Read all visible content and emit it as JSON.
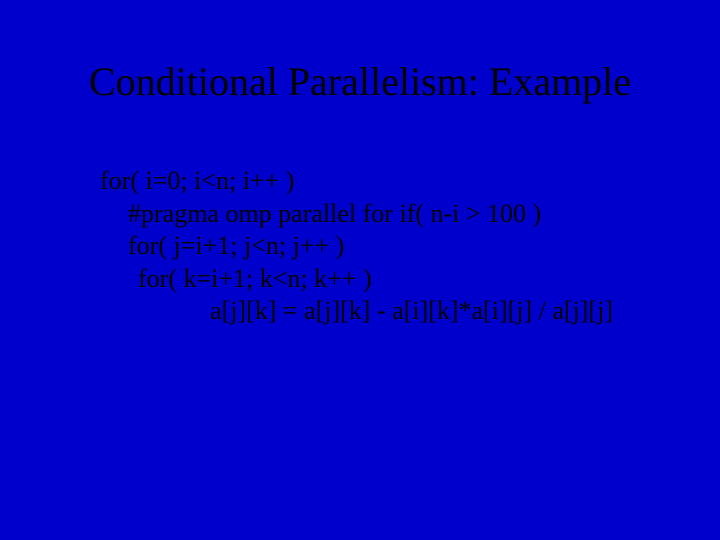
{
  "slide": {
    "title": "Conditional Parallelism: Example",
    "code": {
      "line1": "for( i=0; i<n; i++ )",
      "line2": "#pragma omp parallel for if( n-i > 100 )",
      "line3": "for( j=i+1; j<n; j++ )",
      "line4": "for( k=i+1; k<n; k++ )",
      "line5": "a[j][k] = a[j][k] - a[i][k]*a[i][j] / a[j][j]"
    }
  }
}
